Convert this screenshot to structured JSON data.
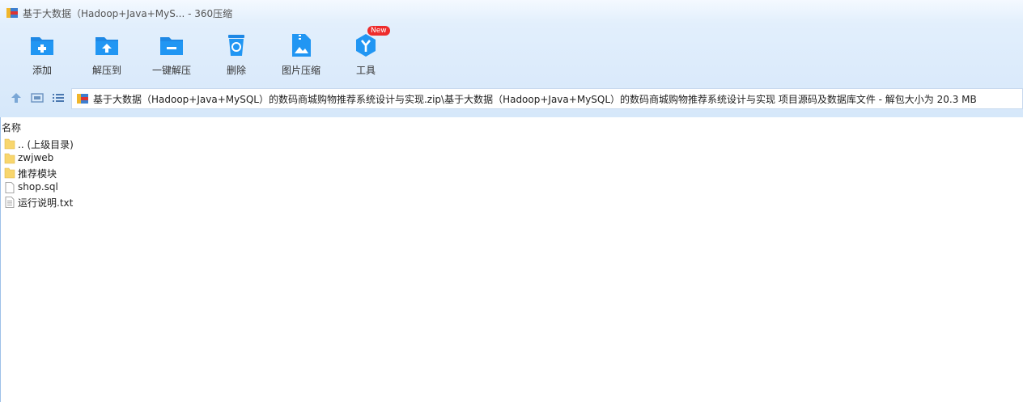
{
  "window": {
    "title": "基于大数据（Hadoop+Java+MyS... - 360压缩"
  },
  "toolbar": {
    "add": "添加",
    "extract_to": "解压到",
    "one_click_extract": "一键解压",
    "delete": "删除",
    "image_compress": "图片压缩",
    "tools": "工具",
    "tools_badge": "New"
  },
  "path": {
    "text": "基于大数据（Hadoop+Java+MySQL）的数码商城购物推荐系统设计与实现.zip\\基于大数据（Hadoop+Java+MySQL）的数码商城购物推荐系统设计与实现 项目源码及数据库文件 - 解包大小为 20.3 MB"
  },
  "list": {
    "column_name": "名称",
    "items": [
      {
        "name": ".. (上级目录)",
        "icon": "folder-icon"
      },
      {
        "name": "zwjweb",
        "icon": "folder-icon"
      },
      {
        "name": "推荐模块",
        "icon": "folder-icon"
      },
      {
        "name": "shop.sql",
        "icon": "file-icon"
      },
      {
        "name": "运行说明.txt",
        "icon": "text-file-icon"
      }
    ]
  },
  "colors": {
    "accent": "#1e88e5",
    "toolbar_bg": "#dcebfb",
    "folder": "#f8d66d",
    "badge": "#ee2c2c"
  }
}
